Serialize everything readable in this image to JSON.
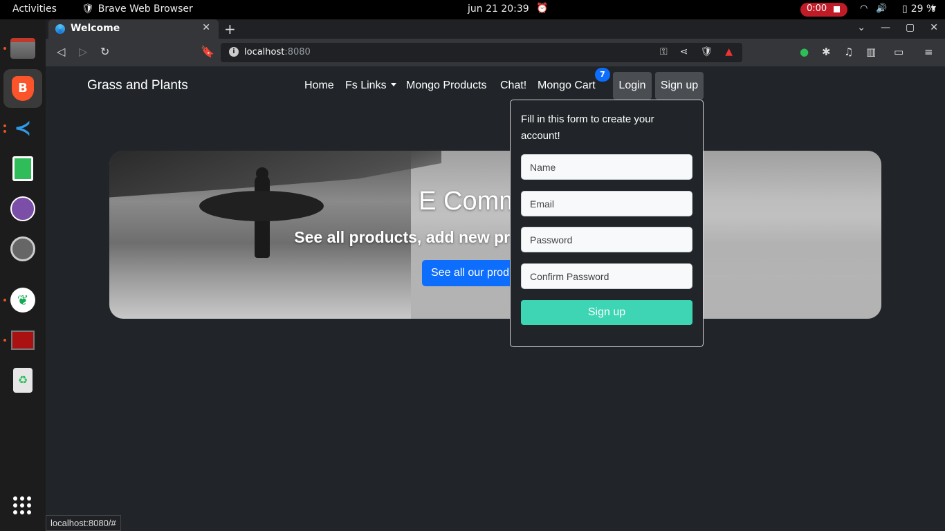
{
  "topbar": {
    "activities": "Activities",
    "app_name": "Brave Web Browser",
    "clock": "jun 21  20:39",
    "recording_time": "0:00",
    "battery": "29 %"
  },
  "dock": {
    "items": [
      "files-icon",
      "brave-browser-icon",
      "vscode-icon",
      "spreadsheet-icon",
      "github-desktop-icon",
      "settings-icon",
      "mongodb-compass-icon",
      "screen-recorder-icon",
      "trash-icon"
    ]
  },
  "browser": {
    "tab_title": "Welcome",
    "url_host": "localhost",
    "url_port": ":8080",
    "status_url": "localhost:8080/#"
  },
  "page": {
    "brand": "Grass and Plants",
    "nav": {
      "home": "Home",
      "fs_links": "Fs Links",
      "mongo_products": "Mongo Products",
      "chat": "Chat!",
      "mongo_cart": "Mongo Cart",
      "cart_count": "7",
      "login": "Login",
      "signup": "Sign up"
    },
    "hero": {
      "title": "E Commerce",
      "subtitle": "See all products, add new products to cart and more!",
      "button": "See all our products"
    },
    "signup_form": {
      "intro": "Fill in this form to create your account!",
      "name_placeholder": "Name",
      "email_placeholder": "Email",
      "password_placeholder": "Password",
      "confirm_placeholder": "Confirm Password",
      "submit": "Sign up"
    }
  },
  "colors": {
    "page_bg": "#212529",
    "primary": "#0d6efd",
    "signup_button": "#3dd5b3",
    "recording": "#c01c28"
  }
}
